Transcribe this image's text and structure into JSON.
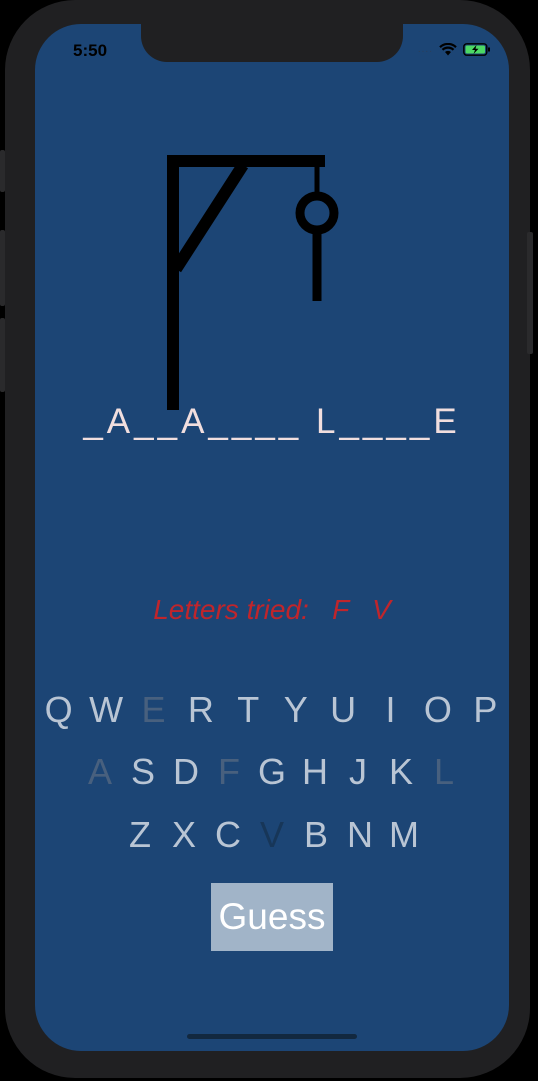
{
  "status_bar": {
    "time": "5:50",
    "signal": "....",
    "wifi_icon": "wifi-icon",
    "battery_icon": "battery-charging-icon",
    "battery_color": "#4cd964"
  },
  "game": {
    "puzzle_word": "_A__A____ L____E",
    "letters_tried_label": "Letters tried:",
    "letters_tried": "F   V"
  },
  "keyboard": {
    "row1": [
      {
        "label": "Q",
        "used": false
      },
      {
        "label": "W",
        "used": false
      },
      {
        "label": "E",
        "used": true
      },
      {
        "label": "R",
        "used": false
      },
      {
        "label": "T",
        "used": false
      },
      {
        "label": "Y",
        "used": false
      },
      {
        "label": "U",
        "used": false
      },
      {
        "label": "I",
        "used": false
      },
      {
        "label": "O",
        "used": false
      },
      {
        "label": "P",
        "used": false
      }
    ],
    "row2": [
      {
        "label": "A",
        "used": true
      },
      {
        "label": "S",
        "used": false
      },
      {
        "label": "D",
        "used": false
      },
      {
        "label": "F",
        "used": true
      },
      {
        "label": "G",
        "used": false
      },
      {
        "label": "H",
        "used": false
      },
      {
        "label": "J",
        "used": false
      },
      {
        "label": "K",
        "used": false
      },
      {
        "label": "L",
        "used": true
      }
    ],
    "row3": [
      {
        "label": "Z",
        "used": false
      },
      {
        "label": "X",
        "used": false
      },
      {
        "label": "C",
        "used": false
      },
      {
        "label": "V",
        "used": true,
        "last": true
      },
      {
        "label": "B",
        "used": false
      },
      {
        "label": "N",
        "used": false
      },
      {
        "label": "M",
        "used": false
      }
    ]
  },
  "guess_button": {
    "label": "Guess"
  },
  "colors": {
    "background": "#1c4575",
    "word": "#f1dede",
    "tried": "#c0252b",
    "key": "#b9c5d4",
    "key_used": "#48607e",
    "button": "#a1b4c8"
  }
}
